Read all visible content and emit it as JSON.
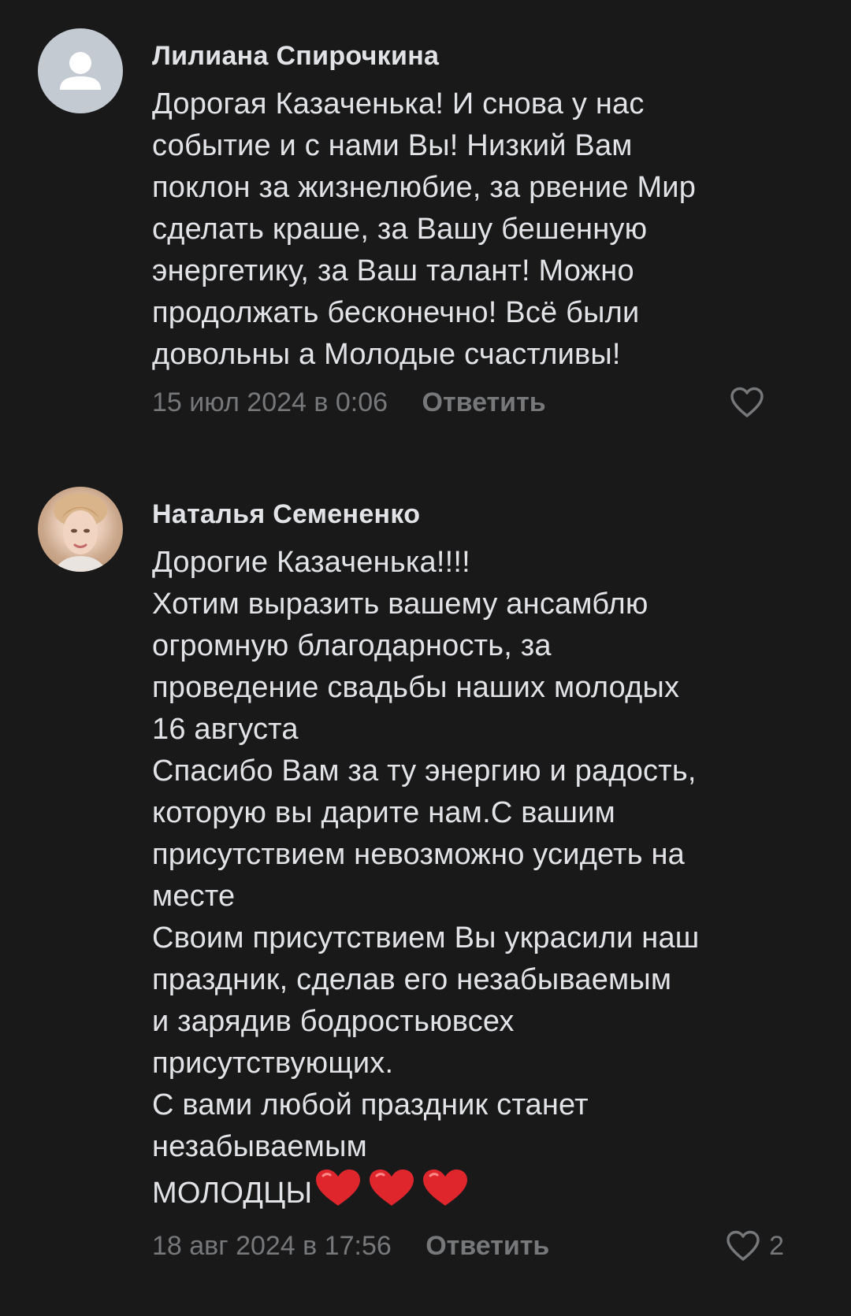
{
  "comments": [
    {
      "author": "Лилиана Спирочкина",
      "text": "Дорогая Казаченька! И снова у нас\nсобытие и с нами Вы! Низкий Вам\nпоклон за жизнелюбие, за рвение Мир\nсделать краше, за Вашу бешенную\nэнергетику, за Ваш талант! Можно\nпродолжать бесконечно! Всё были\nдовольны а Молодые счастливы!",
      "date": "15 июл 2024 в 0:06",
      "reply_label": "Ответить",
      "like_count": "",
      "avatar_icon": "user-placeholder-icon"
    },
    {
      "author": "Наталья Семененко",
      "text": "Дорогие Казаченька!!!!\nХотим выразить  вашему ансамблю\nогромную благодарность, за\nпроведение свадьбы наших молодых\n16 августа\nСпасибо Вам за ту энергию и радость,\nкоторую вы дарите нам.С вашим\nприсутствием невозможно  усидеть  на\nместе\nСвоим присутствием Вы украсили наш\nпраздник, сделав его незабываемым\nи зарядив бодростьювсех\nприсутствующих.\nС вами любой праздник станет\nнезабываемым\nМОЛОДЦЫ",
      "emoji_count": 3,
      "date": "18 авг 2024 в 17:56",
      "reply_label": "Ответить",
      "like_count": "2",
      "avatar_icon": "user-photo"
    }
  ],
  "colors": {
    "background": "#19191a",
    "text": "#e1e3e6",
    "secondary": "#76787a",
    "heart_emoji": "#e0262d"
  }
}
